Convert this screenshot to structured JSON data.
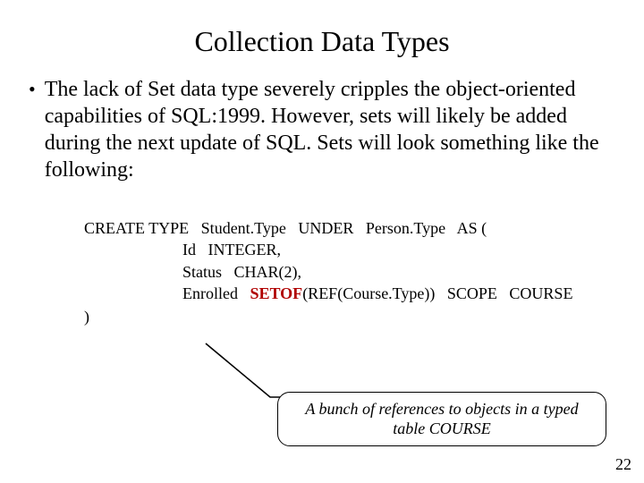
{
  "title": "Collection Data Types",
  "bullet": "The lack of Set data type severely cripples the object-oriented capabilities of SQL:1999. However, sets will likely be added during the next update of SQL. Sets will look something like the following:",
  "code": {
    "l1": "CREATE TYPE   Student.Type   UNDER   Person.Type   AS (",
    "l2": "Id   INTEGER,",
    "l3": "Status   CHAR(2),",
    "l4a": "Enrolled   ",
    "l4b": "SETOF",
    "l4c": "(REF(Course.Type))   SCOPE   COURSE",
    "close": ")"
  },
  "callout": {
    "line1": "A bunch of references to objects in a typed",
    "line2_prefix": "table   ",
    "line2_mono": "COURSE"
  },
  "page": "22"
}
